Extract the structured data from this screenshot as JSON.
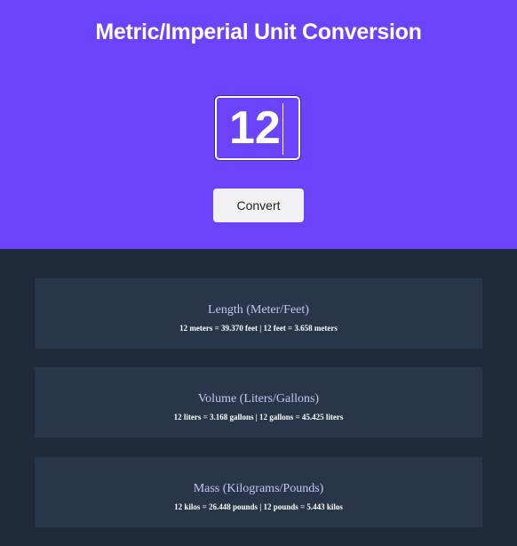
{
  "header": {
    "title": "Metric/Imperial Unit Conversion",
    "input_value": "12",
    "convert_label": "Convert"
  },
  "results": [
    {
      "title": "Length (Meter/Feet)",
      "text": "12 meters = 39.370 feet | 12 feet = 3.658 meters"
    },
    {
      "title": "Volume (Liters/Gallons)",
      "text": "12 liters = 3.168 gallons | 12 gallons = 45.425 liters"
    },
    {
      "title": "Mass (Kilograms/Pounds)",
      "text": "12 kilos = 26.448 pounds | 12 pounds = 5.443 kilos"
    }
  ],
  "colors": {
    "header_bg": "#6a43fb",
    "body_bg": "#1f2b3a",
    "card_bg": "#273749",
    "card_title": "#c8c3f6"
  }
}
